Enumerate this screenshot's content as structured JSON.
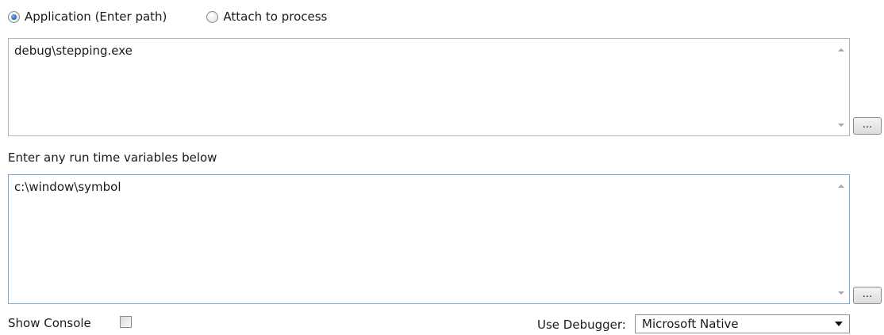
{
  "mode": {
    "options": [
      {
        "label": "Application (Enter path)",
        "selected": true
      },
      {
        "label": "Attach to process",
        "selected": false
      }
    ]
  },
  "app_path": {
    "value": "debug\\stepping.exe",
    "browse_label": "..."
  },
  "run_vars": {
    "label": "Enter any run time variables below",
    "value": "c:\\window\\symbol",
    "browse_label": "..."
  },
  "console": {
    "label": "Show Console",
    "checked": false
  },
  "debugger": {
    "label": "Use Debugger:",
    "selected": "Microsoft Native"
  },
  "colors": {
    "border": "#b5b5b5",
    "focus_border": "#7ea7d8",
    "radio_accent": "#2a6fc6"
  }
}
